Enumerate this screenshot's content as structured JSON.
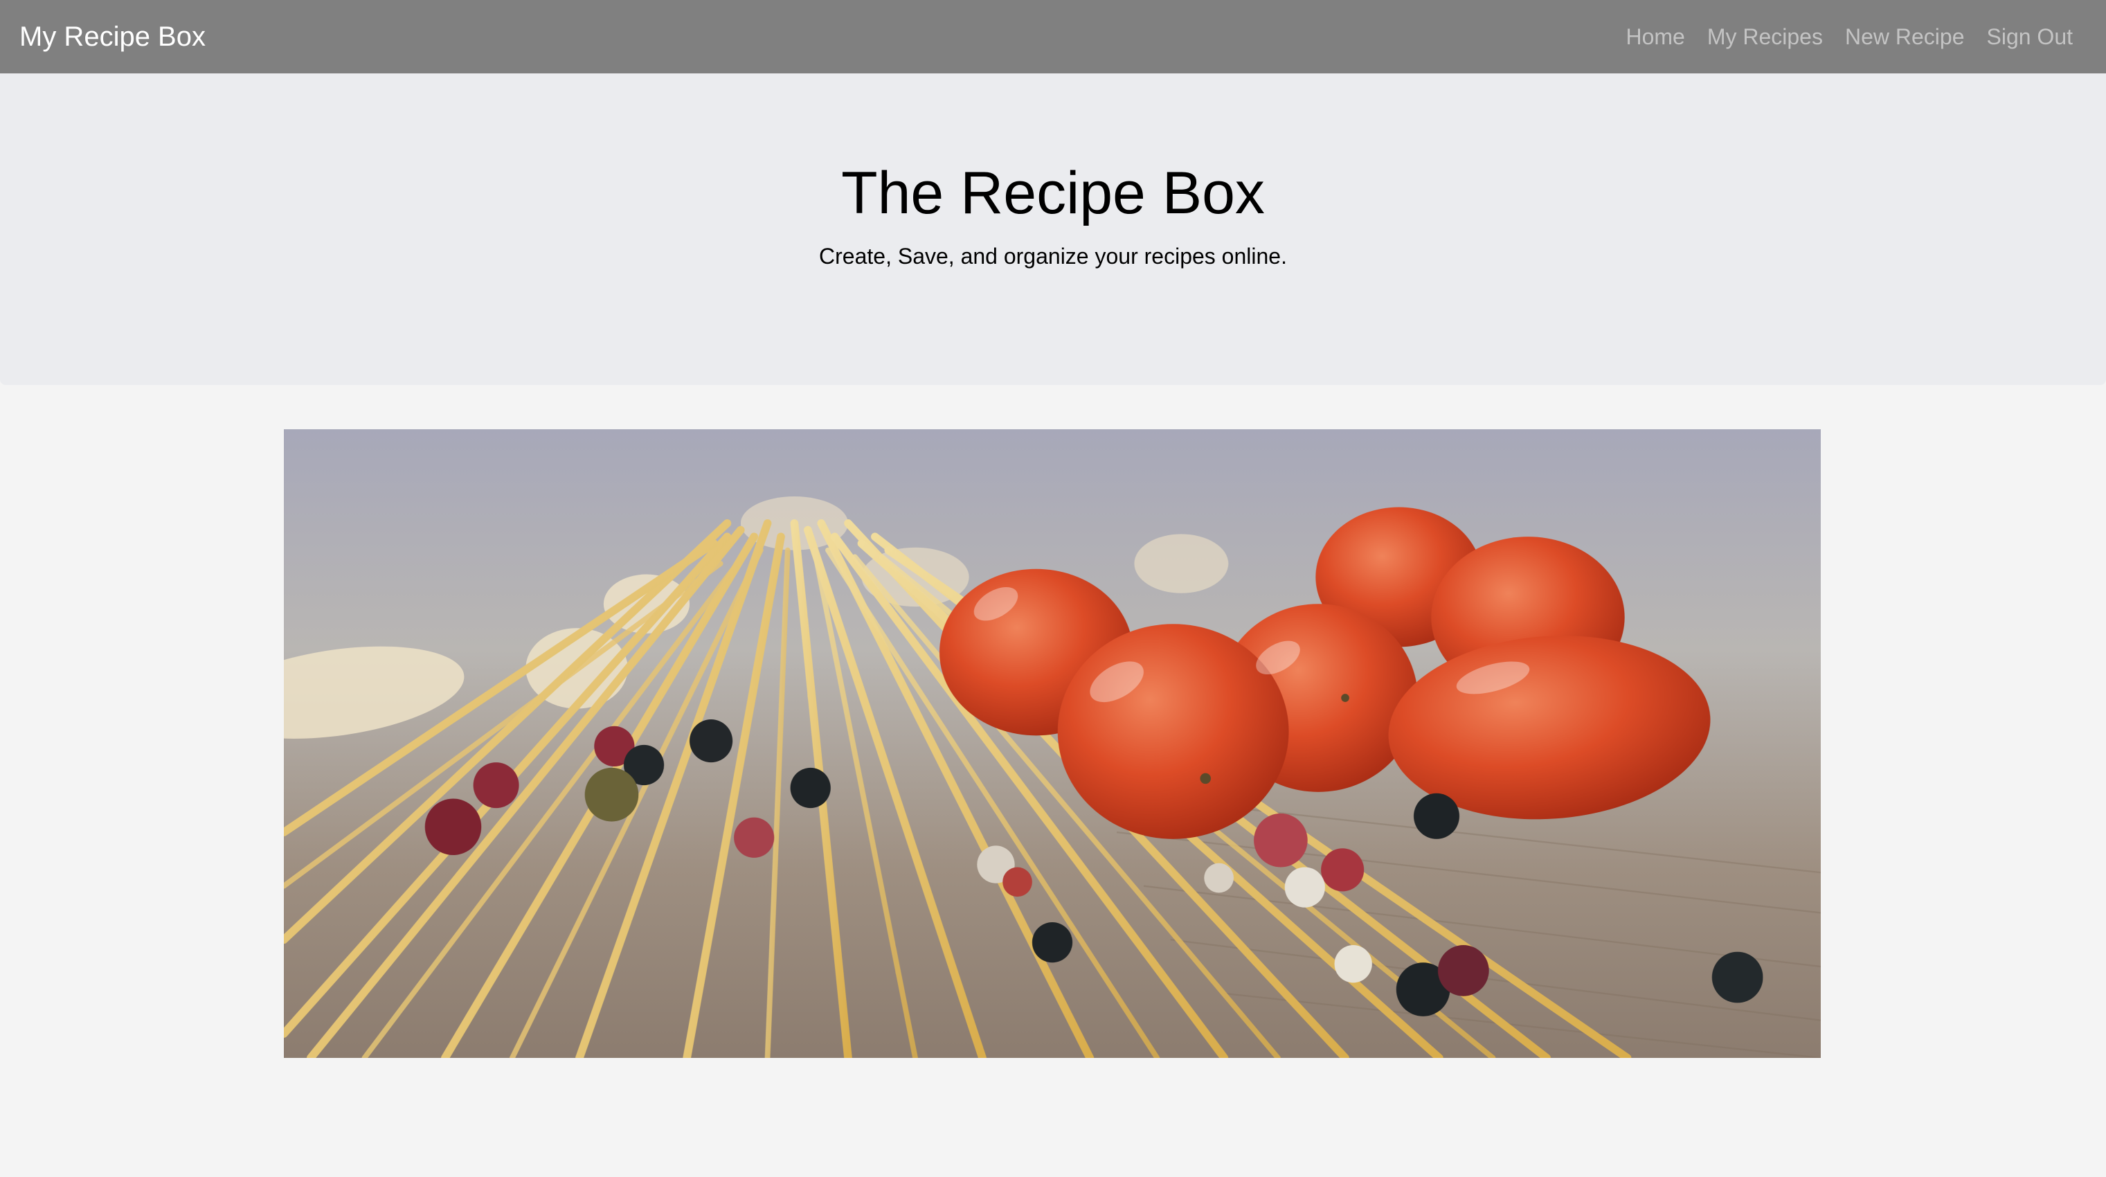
{
  "navbar": {
    "brand": "My Recipe Box",
    "links": [
      "Home",
      "My Recipes",
      "New Recipe",
      "Sign Out"
    ]
  },
  "hero": {
    "title": "The Recipe Box",
    "subtitle": "Create, Save, and organize your recipes online."
  },
  "colors": {
    "navbar_bg": "#808080",
    "hero_bg": "#ebecef",
    "page_bg": "#f4f4f4"
  },
  "photo": {
    "subject": "spaghetti-tomatoes-peppercorns-image"
  }
}
